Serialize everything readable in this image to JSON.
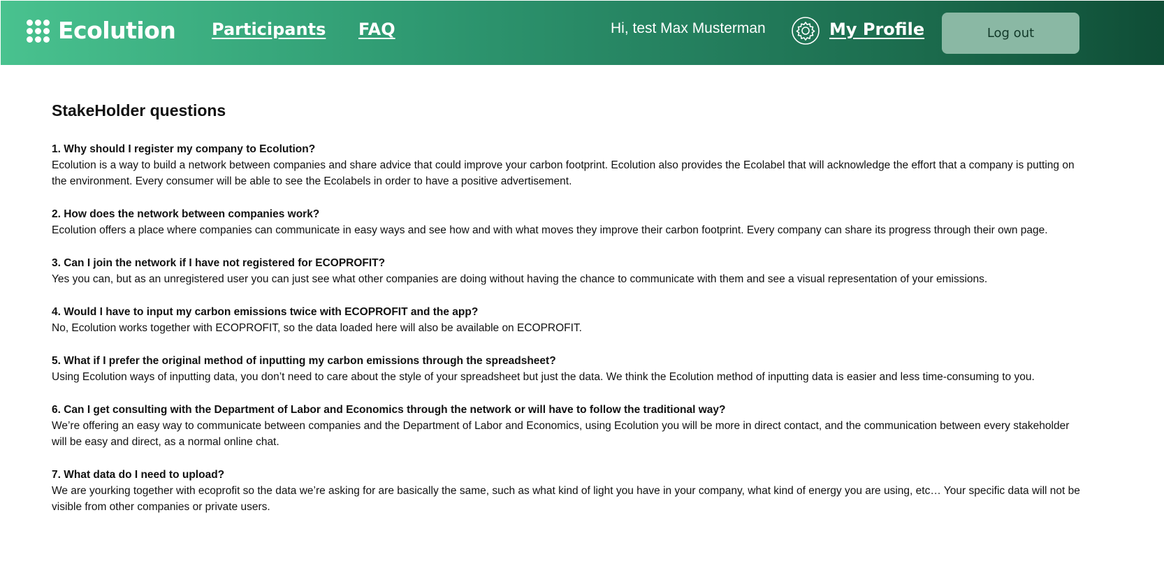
{
  "header": {
    "logo_text": "Ecolution",
    "nav": [
      {
        "label": "Participants"
      },
      {
        "label": "FAQ"
      }
    ],
    "greeting": "Hi, test Max Musterman",
    "profile_label": "My Profile",
    "logout_label": "Log out"
  },
  "main": {
    "title": "StakeHolder questions",
    "faqs": [
      {
        "question": "1. Why should I register my company to Ecolution?",
        "answer": "Ecolution is a way to build a network between companies and share advice that could improve your carbon footprint. Ecolution also provides the Ecolabel that will acknowledge the effort that a company is putting on the environment. Every consumer will be able to see the Ecolabels in order to have a positive advertisement."
      },
      {
        "question": "2. How does the network between companies work?",
        "answer": "Ecolution offers a place where companies can communicate in easy ways and see how and with what moves they improve their carbon footprint. Every company can share its progress through their own page."
      },
      {
        "question": "3. Can I join the network if I have not registered for ECOPROFIT?",
        "answer": "Yes you can, but as an unregistered user you can just see what other companies are doing without having the chance to communicate with them and see a visual representation of your emissions."
      },
      {
        "question": "4. Would I have to input my carbon emissions twice with ECOPROFIT and the app?",
        "answer": "No, Ecolution works together with ECOPROFIT, so the data loaded here will also be available on ECOPROFIT."
      },
      {
        "question": "5. What if I prefer the original method of inputting my carbon emissions through the spreadsheet?",
        "answer": "Using Ecolution ways of inputting data, you don’t need to care about the style of your spreadsheet but just the data. We think the Ecolution method of inputting data is easier and less time-consuming to you."
      },
      {
        "question": "6. Can I get consulting with the Department of Labor and Economics through the network or will have to follow the traditional way?",
        "answer": "We’re offering an easy way to communicate between companies and the Department of Labor and Economics, using Ecolution you will be more in direct contact, and the communication between every stakeholder will be easy and direct, as a normal online chat."
      },
      {
        "question": "7. What data do I need to upload?",
        "answer": "We are yourking together with ecoprofit so the data we’re asking for are basically the same, such as what kind of light you have in your company, what kind of energy you are using, etc… Your specific data will not be visible from other companies or private users."
      }
    ]
  }
}
